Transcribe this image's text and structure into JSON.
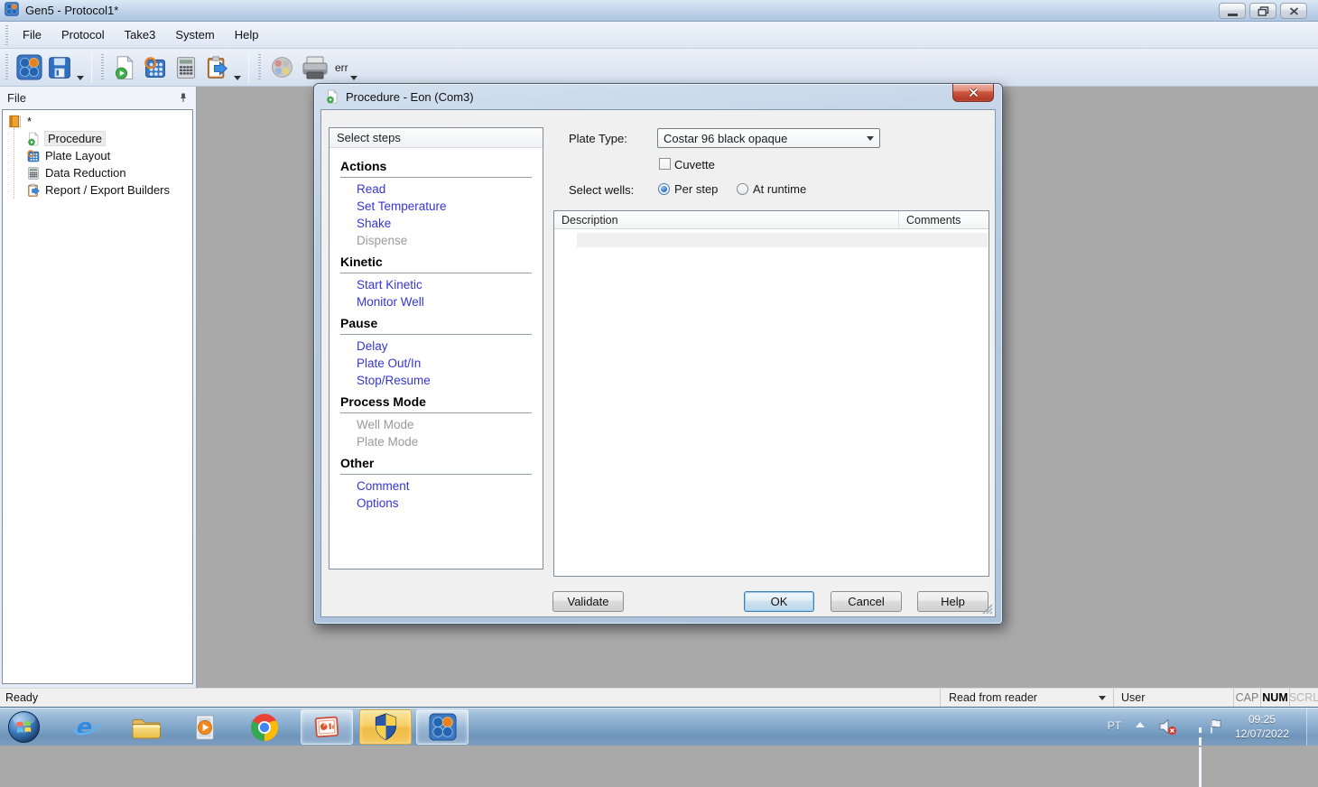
{
  "window": {
    "title": "Gen5 - Protocol1*"
  },
  "menu": {
    "items": [
      {
        "label": "File"
      },
      {
        "label": "Protocol"
      },
      {
        "label": "Take3"
      },
      {
        "label": "System"
      },
      {
        "label": "Help"
      }
    ]
  },
  "toolbar": {
    "printer_err_label": "err"
  },
  "file_panel": {
    "title": "File",
    "root_label": "*",
    "items": [
      {
        "label": "Procedure",
        "selected": true
      },
      {
        "label": "Plate Layout",
        "selected": false
      },
      {
        "label": "Data Reduction",
        "selected": false
      },
      {
        "label": "Report / Export Builders",
        "selected": false
      }
    ]
  },
  "dialog": {
    "title": "Procedure - Eon (Com3)",
    "select_steps": {
      "header": "Select steps",
      "sections": [
        {
          "title": "Actions",
          "items": [
            {
              "label": "Read",
              "enabled": true
            },
            {
              "label": "Set Temperature",
              "enabled": true
            },
            {
              "label": "Shake",
              "enabled": true
            },
            {
              "label": "Dispense",
              "enabled": false
            }
          ]
        },
        {
          "title": "Kinetic",
          "items": [
            {
              "label": "Start Kinetic",
              "enabled": true
            },
            {
              "label": "Monitor Well",
              "enabled": true
            }
          ]
        },
        {
          "title": "Pause",
          "items": [
            {
              "label": "Delay",
              "enabled": true
            },
            {
              "label": "Plate Out/In",
              "enabled": true
            },
            {
              "label": "Stop/Resume",
              "enabled": true
            }
          ]
        },
        {
          "title": "Process Mode",
          "items": [
            {
              "label": "Well Mode",
              "enabled": false
            },
            {
              "label": "Plate Mode",
              "enabled": false
            }
          ]
        },
        {
          "title": "Other",
          "items": [
            {
              "label": "Comment",
              "enabled": true
            },
            {
              "label": "Options",
              "enabled": true
            }
          ]
        }
      ]
    },
    "plate_type": {
      "label": "Plate Type:",
      "value": "Costar 96 black opaque"
    },
    "cuvette": {
      "label": "Cuvette",
      "checked": false
    },
    "select_wells": {
      "label": "Select wells:",
      "options": [
        {
          "label": "Per step",
          "selected": true
        },
        {
          "label": "At runtime",
          "selected": false
        }
      ]
    },
    "table": {
      "columns": [
        {
          "label": "Description"
        },
        {
          "label": "Comments"
        }
      ]
    },
    "buttons": [
      {
        "label": "Validate"
      },
      {
        "label": "OK"
      },
      {
        "label": "Cancel"
      },
      {
        "label": "Help"
      }
    ]
  },
  "status_bar": {
    "ready": "Ready",
    "reader": "Read from reader",
    "user": "User",
    "locks": [
      {
        "label": "CAP",
        "state": "dim"
      },
      {
        "label": "NUM",
        "state": "on"
      },
      {
        "label": "SCRL",
        "state": "off"
      }
    ]
  },
  "taskbar": {
    "language": "PT",
    "time": "09:25",
    "date": "12/07/2022"
  },
  "colors": {
    "step_link": "#3636d2",
    "step_disabled": "#9a9a9a",
    "dialog_close_red": "#c0452f",
    "attention_button": "#f3c85b",
    "workspace_gray": "#a9a9a9"
  }
}
